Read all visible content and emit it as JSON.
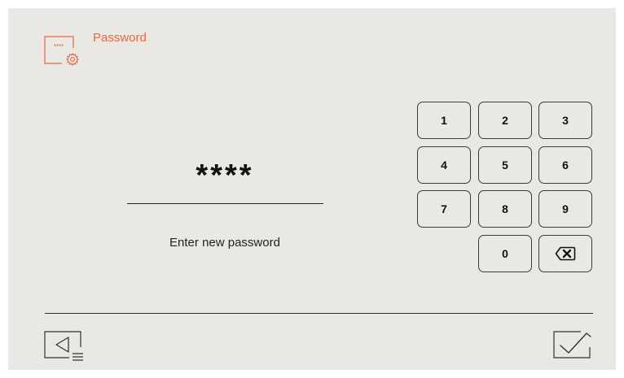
{
  "header": {
    "title": "Password",
    "icon_mask": "****"
  },
  "password": {
    "value": "****",
    "hint": "Enter new password"
  },
  "keypad": {
    "keys": [
      "1",
      "2",
      "3",
      "4",
      "5",
      "6",
      "7",
      "8",
      "9",
      "0"
    ],
    "delete_icon": "backspace-icon"
  },
  "footer": {
    "back_icon": "back-menu-icon",
    "confirm_icon": "checkmark-icon"
  },
  "colors": {
    "accent": "#e8663d",
    "background": "#eae8e5",
    "outline": "#3a3a3a"
  }
}
